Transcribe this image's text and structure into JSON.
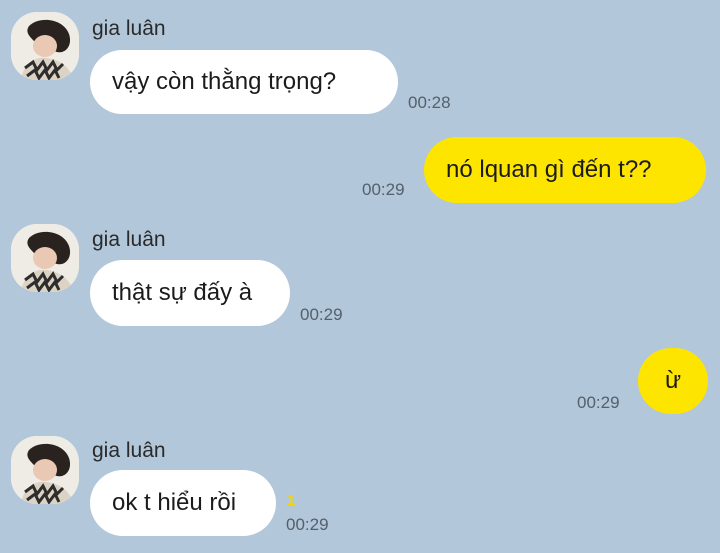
{
  "messages": [
    {
      "sender": "gia luân",
      "text": "vậy còn thằng trọng?",
      "time": "00:28"
    },
    {
      "text": "nó lquan gì đến t??",
      "time": "00:29"
    },
    {
      "sender": "gia luân",
      "text": "thật sự đấy à",
      "time": "00:29"
    },
    {
      "text": "ừ",
      "time": "00:29"
    },
    {
      "sender": "gia luân",
      "text": "ok t hiểu rồi",
      "time": "00:29",
      "unread": "1"
    }
  ],
  "colors": {
    "background": "#b2c7da",
    "incoming_bubble": "#ffffff",
    "outgoing_bubble": "#fee500",
    "timestamp": "#54606b",
    "unread_count": "#f5d400"
  },
  "icons": {
    "avatar": "profile-photo-avatar"
  }
}
